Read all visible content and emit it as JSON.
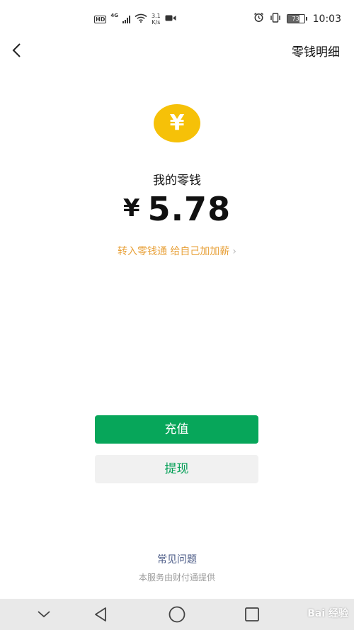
{
  "status_bar": {
    "hd": "HD",
    "network": "4G",
    "speed_value": "3.1",
    "speed_unit": "K/s",
    "battery": "73",
    "battery_level": 0.73,
    "time": "10:03"
  },
  "header": {
    "detail_link": "零钱明细"
  },
  "coin_symbol": "¥",
  "balance": {
    "label": "我的零钱",
    "currency": "¥",
    "amount": "5.78"
  },
  "promo": {
    "text": "转入零钱通 给自己加加薪",
    "chevron": "›"
  },
  "actions": {
    "recharge_label": "充值",
    "withdraw_label": "提现"
  },
  "footer": {
    "faq_label": "常见问题",
    "provider_text": "本服务由财付通提供"
  },
  "watermark": "Bai 经验",
  "colors": {
    "primary_green": "#07a65a",
    "coin_yellow": "#f6c108",
    "promo_orange": "#e8a13a",
    "link_blue": "#4a5a86"
  }
}
